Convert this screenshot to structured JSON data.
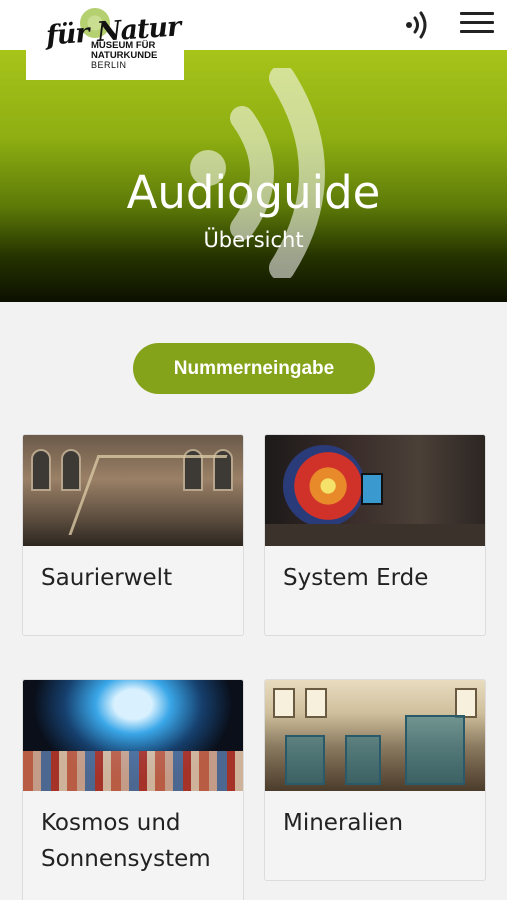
{
  "header": {
    "logo": {
      "script_text": "für Natur",
      "line1": "MUSEUM FÜR",
      "line2": "NATURKUNDE",
      "line3": "BERLIN"
    },
    "audio_icon": "audio-waves-icon",
    "menu_icon": "hamburger-menu-icon"
  },
  "hero": {
    "title": "Audioguide",
    "subtitle": "Übersicht",
    "colors": {
      "top": "#a7c41a",
      "bottom": "#0c1000"
    }
  },
  "number_button": {
    "label": "Nummerneingabe",
    "color": "#85a31a"
  },
  "cards": [
    {
      "label": "Saurierwelt"
    },
    {
      "label": "System Erde"
    },
    {
      "label": "Kosmos und Sonnensystem"
    },
    {
      "label": "Mineralien"
    }
  ]
}
